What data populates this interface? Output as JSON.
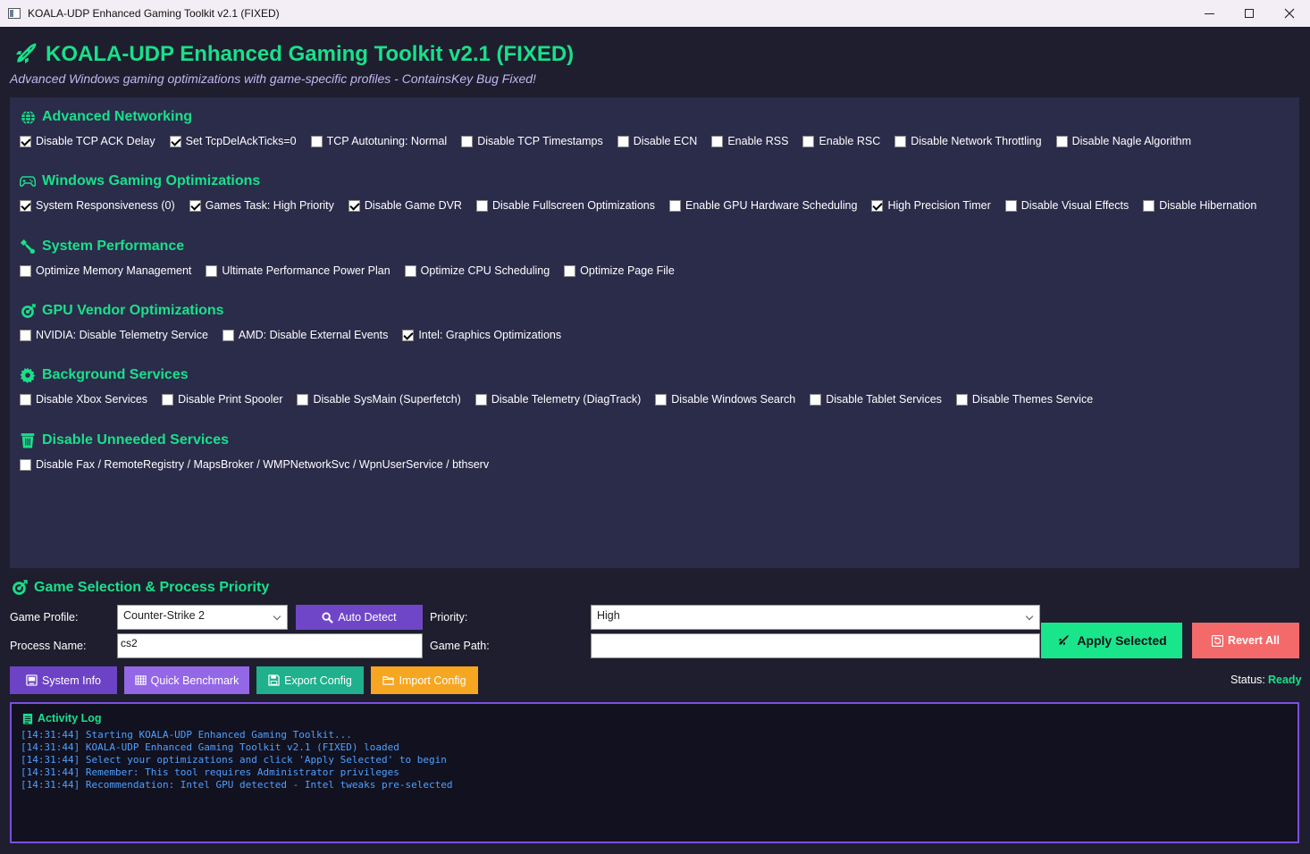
{
  "window": {
    "title": "KOALA-UDP Enhanced Gaming Toolkit v2.1 (FIXED)",
    "controls": [
      "minimize",
      "maximize",
      "close"
    ]
  },
  "header": {
    "title": "KOALA-UDP Enhanced Gaming Toolkit v2.1 (FIXED)",
    "subtitle": "Advanced Windows gaming optimizations with game-specific profiles - ContainsKey Bug Fixed!",
    "icon": "rocket-icon"
  },
  "colors": {
    "accent": "#19e08a",
    "panel": "#2b2b4a",
    "background": "#1e1e2e",
    "log_text": "#4ea0ff",
    "log_border": "#7c4fe0"
  },
  "sections": [
    {
      "title": "Advanced Networking",
      "icon": "globe-icon",
      "options": [
        {
          "label": "Disable TCP ACK Delay",
          "checked": true
        },
        {
          "label": "Set TcpDelAckTicks=0",
          "checked": true
        },
        {
          "label": "TCP Autotuning: Normal",
          "checked": false
        },
        {
          "label": "Disable TCP Timestamps",
          "checked": false
        },
        {
          "label": "Disable ECN",
          "checked": false
        },
        {
          "label": "Enable RSS",
          "checked": false
        },
        {
          "label": "Enable RSC",
          "checked": false
        },
        {
          "label": "Disable Network Throttling",
          "checked": false
        },
        {
          "label": "Disable Nagle Algorithm",
          "checked": false
        }
      ]
    },
    {
      "title": "Windows Gaming Optimizations",
      "icon": "gamepad-icon",
      "options": [
        {
          "label": "System Responsiveness (0)",
          "checked": true
        },
        {
          "label": "Games Task: High Priority",
          "checked": true
        },
        {
          "label": "Disable Game DVR",
          "checked": true
        },
        {
          "label": "Disable Fullscreen Optimizations",
          "checked": false
        },
        {
          "label": "Enable GPU Hardware Scheduling",
          "checked": false
        },
        {
          "label": "High Precision Timer",
          "checked": true
        },
        {
          "label": "Disable Visual Effects",
          "checked": false
        },
        {
          "label": "Disable Hibernation",
          "checked": false
        }
      ]
    },
    {
      "title": "System Performance",
      "icon": "wrench-icon",
      "options": [
        {
          "label": "Optimize Memory Management",
          "checked": false
        },
        {
          "label": "Ultimate Performance Power Plan",
          "checked": false
        },
        {
          "label": "Optimize CPU Scheduling",
          "checked": false
        },
        {
          "label": "Optimize Page File",
          "checked": false
        }
      ]
    },
    {
      "title": "GPU Vendor Optimizations",
      "icon": "target-icon",
      "options": [
        {
          "label": "NVIDIA: Disable Telemetry Service",
          "checked": false
        },
        {
          "label": "AMD: Disable External Events",
          "checked": false
        },
        {
          "label": "Intel: Graphics Optimizations",
          "checked": true
        }
      ]
    },
    {
      "title": "Background Services",
      "icon": "gear-icon",
      "options": [
        {
          "label": "Disable Xbox Services",
          "checked": false
        },
        {
          "label": "Disable Print Spooler",
          "checked": false
        },
        {
          "label": "Disable SysMain (Superfetch)",
          "checked": false
        },
        {
          "label": "Disable Telemetry (DiagTrack)",
          "checked": false
        },
        {
          "label": "Disable Windows Search",
          "checked": false
        },
        {
          "label": "Disable Tablet Services",
          "checked": false
        },
        {
          "label": "Disable Themes Service",
          "checked": false
        }
      ]
    },
    {
      "title": "Disable Unneeded Services",
      "icon": "trash-icon",
      "options": [
        {
          "label": "Disable Fax / RemoteRegistry / MapsBroker / WMPNetworkSvc / WpnUserService / bthserv",
          "checked": false
        }
      ]
    }
  ],
  "game": {
    "title": "Game Selection & Process Priority",
    "icon": "target-icon",
    "profile_label": "Game Profile:",
    "profile_value": "Counter-Strike 2",
    "auto_detect": "Auto Detect",
    "priority_label": "Priority:",
    "priority_value": "High",
    "process_label": "Process Name:",
    "process_value": "cs2",
    "path_label": "Game Path:",
    "path_value": ""
  },
  "actions": {
    "apply": "Apply Selected",
    "revert": "Revert All",
    "system_info": "System Info",
    "benchmark": "Quick Benchmark",
    "export": "Export Config",
    "import": "Import Config"
  },
  "status": {
    "label": "Status:",
    "value": "Ready"
  },
  "log": {
    "title": "Activity Log",
    "lines": [
      "[14:31:44] Starting KOALA-UDP Enhanced Gaming Toolkit...",
      "[14:31:44] KOALA-UDP Enhanced Gaming Toolkit v2.1 (FIXED) loaded",
      "[14:31:44] Select your optimizations and click 'Apply Selected' to begin",
      "[14:31:44] Remember: This tool requires Administrator privileges",
      "[14:31:44] Recommendation: Intel GPU detected - Intel tweaks pre-selected"
    ]
  }
}
